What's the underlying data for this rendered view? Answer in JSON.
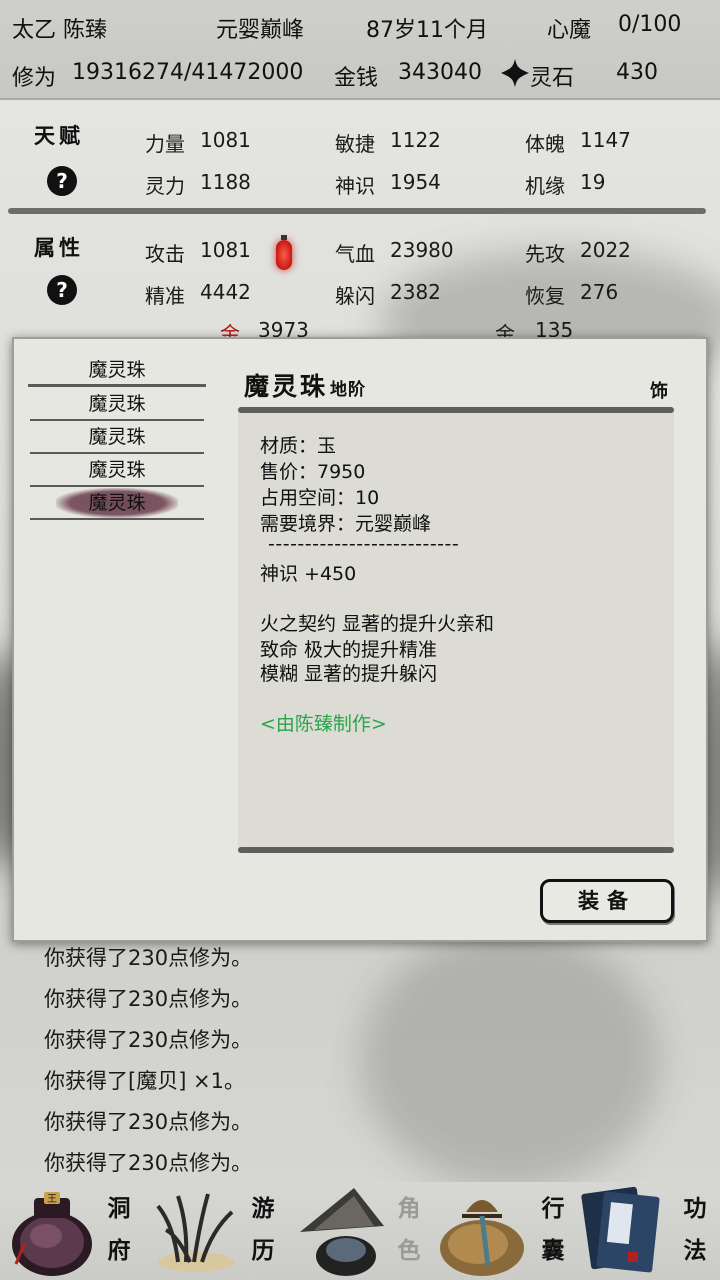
{
  "header": {
    "name": "太乙 陈臻",
    "realm": "元婴巅峰",
    "age": "87岁11个月",
    "xinmo_label": "心魔",
    "xinmo_value": "0/100",
    "xiuwei_label": "修为",
    "xiuwei_value": "19316274/41472000",
    "money_label": "金钱",
    "money_value": "343040",
    "lingshi_label": "灵石",
    "lingshi_value": "430"
  },
  "talent": {
    "title": "天赋",
    "help": "?",
    "stats": [
      {
        "label": "力量",
        "value": "1081"
      },
      {
        "label": "敏捷",
        "value": "1122"
      },
      {
        "label": "体魄",
        "value": "1147"
      },
      {
        "label": "灵力",
        "value": "1188"
      },
      {
        "label": "神识",
        "value": "1954"
      },
      {
        "label": "机缘",
        "value": "19"
      }
    ]
  },
  "attributes": {
    "title": "属性",
    "help": "?",
    "stats": [
      {
        "label": "攻击",
        "value": "1081"
      },
      {
        "label": "气血",
        "value": "23980"
      },
      {
        "label": "先攻",
        "value": "2022"
      },
      {
        "label": "精准",
        "value": "4442"
      },
      {
        "label": "躲闪",
        "value": "2382"
      },
      {
        "label": "恢复",
        "value": "276"
      }
    ],
    "partial": [
      {
        "label": "金",
        "value": "3973"
      },
      {
        "label": "金",
        "value": "135"
      }
    ]
  },
  "modal": {
    "items": [
      "魔灵珠",
      "魔灵珠",
      "魔灵珠",
      "魔灵珠",
      "魔灵珠"
    ],
    "selected_index": 4,
    "item_name": "魔灵珠",
    "item_grade": "地阶",
    "item_slot": "饰",
    "details": {
      "material": "材质：玉",
      "price": "售价：7950",
      "space": "占用空间：10",
      "realm_req": "需要境界：元婴巅峰",
      "separator": "--------------------------",
      "bonus": "神识 +450",
      "effect1": "火之契约 显著的提升火亲和",
      "effect2": "致命 极大的提升精准",
      "effect3": "模糊 显著的提升躲闪",
      "maker": "<由陈臻制作>"
    },
    "equip_label": "装备"
  },
  "log": [
    "你获得了230点修为。",
    "你获得了230点修为。",
    "你获得了230点修为。",
    "你获得了[魔贝] ×1。",
    "你获得了230点修为。",
    "你获得了230点修为。"
  ],
  "nav": [
    {
      "line1": "洞",
      "line2": "府",
      "icon": "cave-pouch-icon"
    },
    {
      "line1": "游",
      "line2": "历",
      "icon": "grass-icon"
    },
    {
      "line1": "角",
      "line2": "色",
      "icon": "straw-hat-icon"
    },
    {
      "line1": "行",
      "line2": "囊",
      "icon": "bag-icon"
    },
    {
      "line1": "功",
      "line2": "法",
      "icon": "books-icon"
    }
  ],
  "colors": {
    "maker_text": "#2aa54a",
    "selected_item_bg": "#7d5663",
    "lantern": "#c40000"
  }
}
